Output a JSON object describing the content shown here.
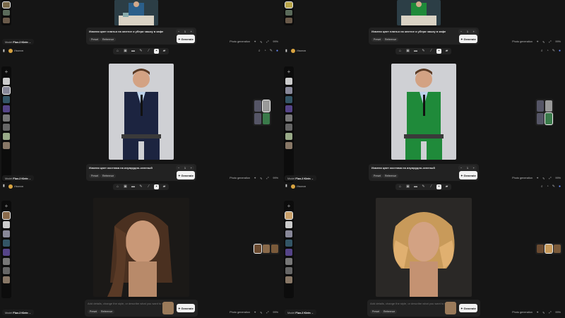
{
  "model": {
    "label": "Model",
    "name": "Flux.2 Klein"
  },
  "user": {
    "name": "Иванов"
  },
  "footer": {
    "mode": "Photo generation",
    "zoom": "99%"
  },
  "prompts": {
    "top": "Измени цвет платья на желтое и убери чашку в кафе",
    "middle": "Измени цвет костюма на изумрудно-зеленый",
    "bottom_placeholder": "Add details, change the style, or describe what you want to see…"
  },
  "chips": {
    "preset": "Preset",
    "reference": "Reference"
  },
  "stepper": {
    "value": "1",
    "minus": "−",
    "plus": "+"
  },
  "generate_label": "Generate",
  "toolbar_icons": [
    "home-icon",
    "image-icon",
    "chat-icon",
    "brush-icon",
    "wand-icon",
    "grid-icon",
    "folder-icon"
  ],
  "top_icons": [
    "search-icon",
    "bell-icon",
    "edit-icon",
    "globe-icon"
  ],
  "colors": {
    "accent": "#f2f2f2",
    "bg": "#111111",
    "panel": "#222222",
    "suit_green": "#1f8a3a",
    "suit_navy": "#1c2440"
  }
}
